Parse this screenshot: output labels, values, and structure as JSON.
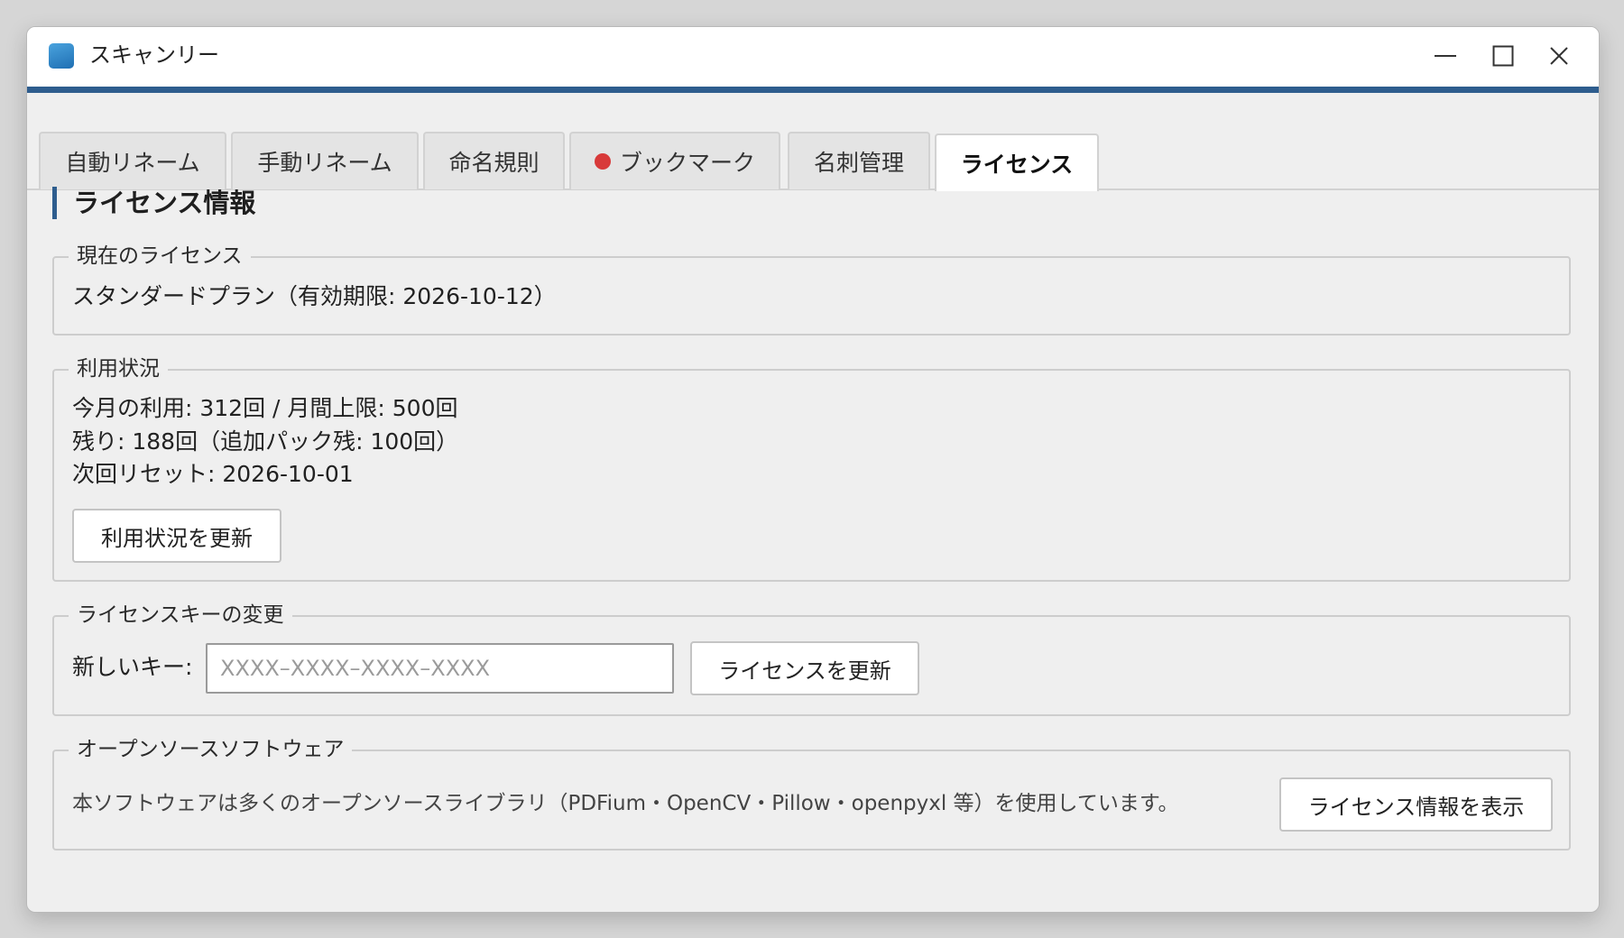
{
  "window": {
    "title": "スキャンリー"
  },
  "tabs": [
    {
      "label": "自動リネーム"
    },
    {
      "label": "手動リネーム"
    },
    {
      "label": "命名規則"
    },
    {
      "label": "ブックマーク",
      "indicator": "red-dot"
    },
    {
      "label": "名刺管理"
    },
    {
      "label": "ライセンス",
      "active": true
    }
  ],
  "page": {
    "heading": "ライセンス情報"
  },
  "current_license": {
    "legend": "現在のライセンス",
    "text": "スタンダードプラン（有効期限: 2026-10-12）"
  },
  "usage": {
    "legend": "利用状況",
    "line1": "今月の利用: 312回 / 月間上限: 500回",
    "line2": "残り: 188回（追加パック残: 100回）",
    "line3": "次回リセット: 2026-10-01",
    "refresh_button": "利用状況を更新"
  },
  "key_change": {
    "legend": "ライセンスキーの変更",
    "field_label": "新しいキー:",
    "placeholder": "XXXX–XXXX–XXXX–XXXX",
    "value": "",
    "update_button": "ライセンスを更新"
  },
  "oss": {
    "legend": "オープンソースソフトウェア",
    "text": "本ソフトウェアは多くのオープンソースライブラリ（PDFium・OpenCV・Pillow・openpyxl 等）を使用しています。",
    "show_button": "ライセンス情報を表示"
  },
  "colors": {
    "accent": "#2e5d8e",
    "indicator": "#d83a3a",
    "background": "#efefef"
  },
  "icons": [
    "app-icon",
    "minimize-icon",
    "maximize-icon",
    "close-icon"
  ]
}
